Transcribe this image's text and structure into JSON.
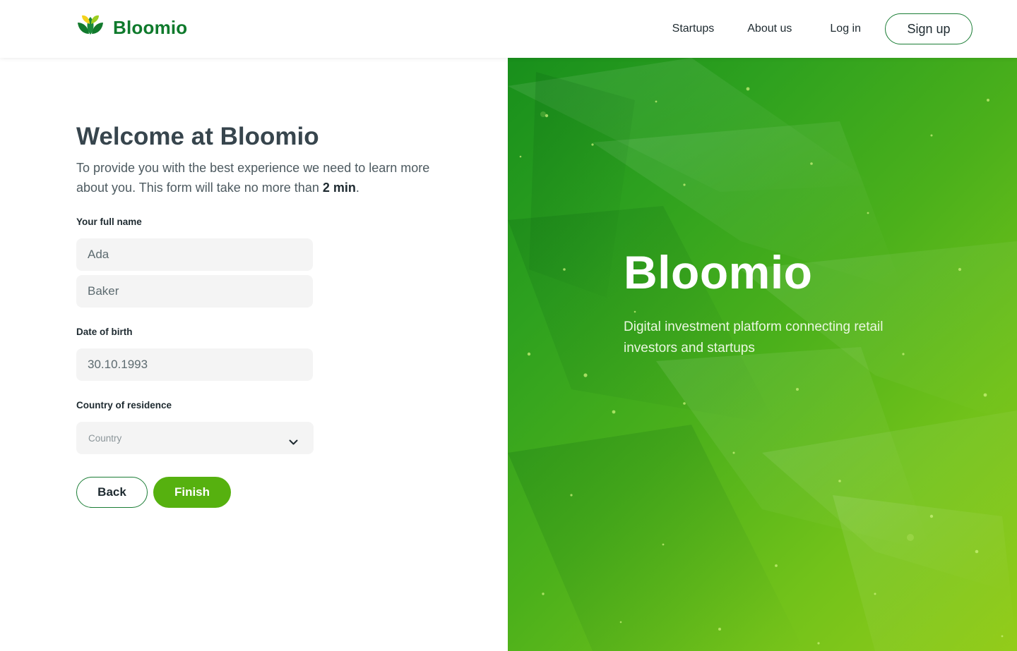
{
  "header": {
    "brand": "Bloomio",
    "nav": {
      "startups": "Startups",
      "about": "About us",
      "login": "Log in",
      "signup": "Sign up"
    }
  },
  "form": {
    "title": "Welcome at Bloomio",
    "subtitle_before": "To provide you with the best experience we need to learn more about you. This form will take no more than ",
    "subtitle_bold": "2 min",
    "subtitle_after": ".",
    "name_label": "Your full name",
    "first_name_value": "Ada",
    "last_name_value": "Baker",
    "dob_label": "Date of birth",
    "dob_value": "30.10.1993",
    "country_label": "Country of residence",
    "country_placeholder": "Country",
    "back_label": "Back",
    "finish_label": "Finish"
  },
  "hero": {
    "title": "Bloomio",
    "subtitle": "Digital investment platform connecting retail investors and startups"
  },
  "colors": {
    "brand_green": "#0f7a2c",
    "button_green": "#56b10f",
    "outline_green": "#1a7d35",
    "hero_start": "#188f1c",
    "hero_end": "#93cc19"
  },
  "icons": {
    "logo": "leaf-logo-icon",
    "select": "chevron-down-icon"
  }
}
